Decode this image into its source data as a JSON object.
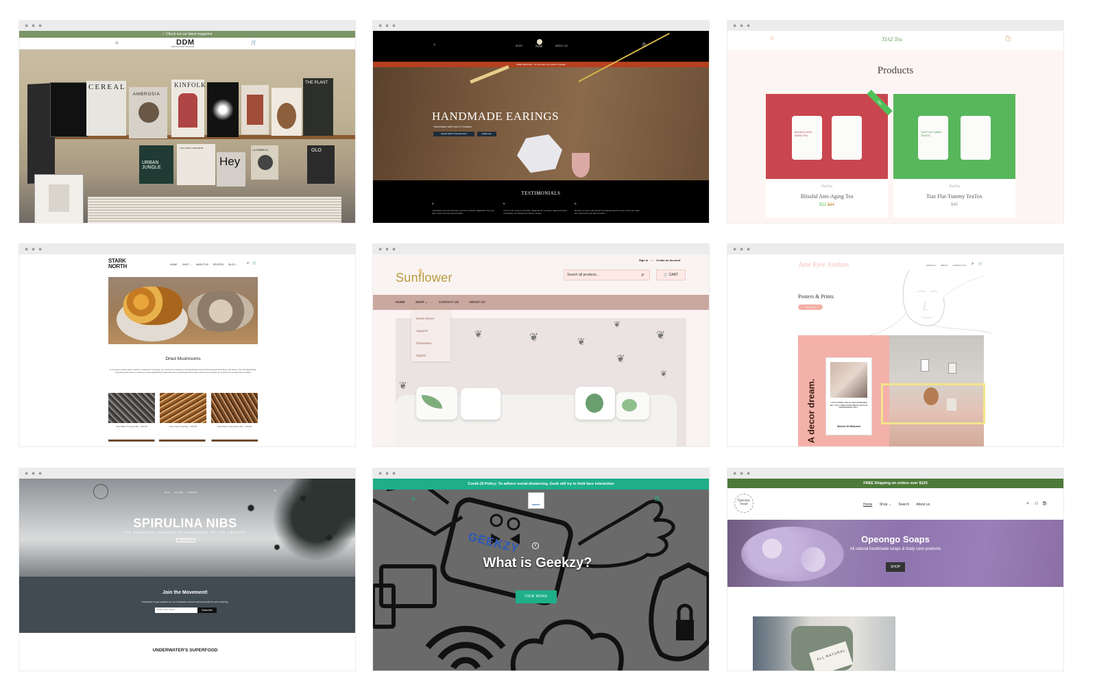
{
  "sites": {
    "ddm": {
      "announcement": "✓ Check out our latest magazine",
      "logo": "DDM",
      "logo_sub": "DESIGN DIGEST MAGAZINE",
      "covers": [
        "CEREAL",
        "KINFOLK",
        "THE PLANT",
        "AMBROSIA",
        "URBAN JUNGLE",
        "Hey",
        "LA FABRICA",
        "OLO",
        "THE LATEST MAGAZINE"
      ]
    },
    "njm": {
      "nav_shop": "SHOP",
      "nav_about": "ABOUT US",
      "logo": "NJM",
      "banner": "FREE SHIPPING · On all orders over $150 in Canada",
      "hero_title": "HANDMADE EARINGS",
      "hero_sub": "Handmade with love in Canada",
      "btn_collection": "SHOP NEXT COLLECTION",
      "btn_all": "SHOP ALL",
      "testimonials": "TESTIMONIALS",
      "quotes": [
        "I absolutely love the earrings I got from Northern Magnolia! They are light, super cute and good quality!",
        "I know I can count on Northern Magnolia for a unique, statement piece of jewellery. Its settings are always unique",
        "Bought my sister earrings for her birthday and the look on her face after she opened the gift was priceless"
      ]
    },
    "tiaz": {
      "logo": "TIAZ Tea",
      "page_title": "Products",
      "badge": "Sale",
      "products": [
        {
          "vendor": "TiazTea",
          "name": "Blissful Anti-Aging Tea",
          "price": "$22",
          "compare": "$24",
          "pouch": "BLISSFUL ANTI-AGING TEA"
        },
        {
          "vendor": "TiazTea",
          "name": "Tiaz Flat-Tummy TeaTox",
          "price": "$45",
          "compare": "",
          "pouch": "TIAZ FLAT-TUMMY TEATOX"
        }
      ]
    },
    "stark": {
      "logo_line1": "STARK",
      "logo_line2": "NORTH",
      "nav": [
        "HOME",
        "SHOP ⌄",
        "ABOUT US",
        "RECIPES",
        "BLOG ⌄"
      ],
      "section_title": "Dried Mushrooms",
      "description": "To provide a product that is superior in taste and complexity, our mushrooms undergo a cold dehydration method that preserves both flavor and texture. The cold dehydration method ensures that our mushrooms taste significantly fresher than those dehydrated with a heat method and it protects the mushrooms' complex flavor profiles.",
      "products": [
        {
          "name": "Dried Black Trumpets 50g — $23.99"
        },
        {
          "name": "Dried Candy Cap 50g — $15.99"
        },
        {
          "name": "Dried Winter Chanterelles 30g — $19.99"
        }
      ]
    },
    "sunflower": {
      "logo": "Sunflower",
      "sign_in": "Sign in",
      "or": "or",
      "create_account": "Create an Account",
      "search_placeholder": "Search all products...",
      "cart": "CART",
      "nav": [
        "HOME",
        "SHOP ⌄",
        "CONTACT US",
        "ABOUT US"
      ],
      "dropdown": [
        "Home Decor",
        "Apparel",
        "Glassware",
        "Digital"
      ]
    },
    "jane": {
      "logo": "Jane Eyre Jordans",
      "nav": [
        "SHOP ALL",
        "ABOUT",
        "CONTACT US"
      ],
      "heading": "Posters & Prints",
      "button": "Shop now",
      "poster_text": "A decor dream.",
      "quote_text": "\"I AM NO BIRD; AND NO NET ENSNARES ME: I AM A FREE HUMAN BEING WITH AN INDEPENDENT WILL.\"",
      "quote_author": "Simone De Beauvoir"
    },
    "spirulina": {
      "logo": "SPIRULINA NIBS",
      "breadcrumb": [
        "Home",
        "Pre-Order",
        "Contact Us"
      ],
      "hero_title": "SPIRULINA NIBS",
      "hero_sub": "THE POWERFUL SUPERFOOD DISCOVERY OF THE CENTURY",
      "hero_button": "COMING SOON",
      "join_title": "Join the Movement!",
      "join_sub": "Subscribe to get updates on our kickstarter launch and discounts for pre-ordering.",
      "email_placeholder": "Enter your email",
      "subscribe": "Subscribe",
      "footer_title": "UNDERWATER'S SUPERFOOD"
    },
    "geekzy": {
      "banner": "Covid-19 Policy: To adhere social distancing, Geek will try to limit face interaction",
      "logo": "GEEKZY",
      "hero_title": "What is Geekzy?",
      "button": "VIEW MORE"
    },
    "opeongo": {
      "banner": "FREE Shipping on orders over $125",
      "logo": "Opeongo Soaps",
      "nav": [
        "Home",
        "Shop ⌄",
        "Search",
        "About us"
      ],
      "hero_title": "Opeongo Soaps",
      "hero_sub": "All natural handmade soaps & body care products",
      "hero_button": "SHOP",
      "label_text": "ALL NATURAL"
    }
  },
  "colors": {
    "ddm_green": "#7b9468",
    "tiaz_red": "#c9464f",
    "tiaz_green": "#58b75c",
    "sunflower_nav": "#c9a8a0",
    "jane_pink": "#f3b1a9",
    "spirulina_slate": "#414b52",
    "geekzy_teal": "#1eaf8a",
    "opeongo_green": "#4d7a39",
    "opeongo_purple": "#8e74ad"
  }
}
